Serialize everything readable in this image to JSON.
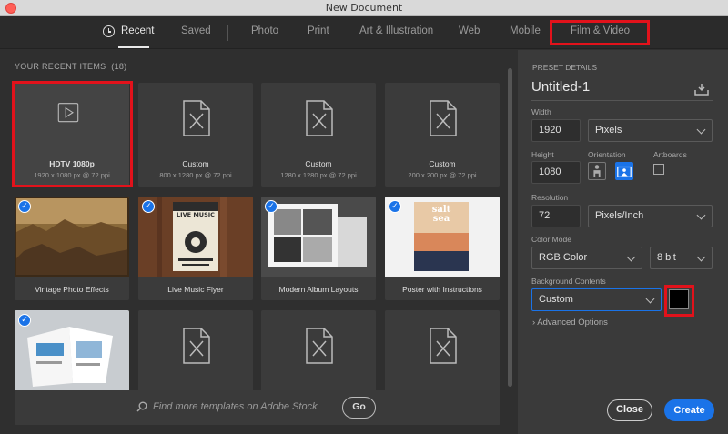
{
  "window": {
    "title": "New Document"
  },
  "tabs": [
    {
      "label": "Recent",
      "active": true
    },
    {
      "label": "Saved"
    },
    {
      "label": "Photo"
    },
    {
      "label": "Print"
    },
    {
      "label": "Art & Illustration"
    },
    {
      "label": "Web"
    },
    {
      "label": "Mobile"
    },
    {
      "label": "Film & Video"
    }
  ],
  "recent": {
    "header": "YOUR RECENT ITEMS",
    "count": "(18)",
    "items": [
      {
        "title": "HDTV 1080p",
        "sub": "1920 x 1080 px @ 72 ppi",
        "icon": "video-icon",
        "selected": true
      },
      {
        "title": "Custom",
        "sub": "800 x 1280 px @ 72 ppi",
        "icon": "document-icon"
      },
      {
        "title": "Custom",
        "sub": "1280 x 1280 px @ 72 ppi",
        "icon": "document-icon"
      },
      {
        "title": "Custom",
        "sub": "200 x 200 px @ 72 ppi",
        "icon": "document-icon"
      },
      {
        "title": "Vintage Photo Effects",
        "checked": true
      },
      {
        "title": "Live Music Flyer",
        "checked": true,
        "thumb_text": "LIVE MUSIC"
      },
      {
        "title": "Modern Album Layouts",
        "checked": true
      },
      {
        "title": "Poster with Instructions",
        "checked": true,
        "thumb_text_1": "salt",
        "thumb_text_2": "sea"
      },
      {
        "title": "",
        "checked": true
      },
      {
        "title": "",
        "icon": "document-icon"
      },
      {
        "title": "",
        "icon": "document-icon"
      },
      {
        "title": "",
        "icon": "document-icon"
      }
    ]
  },
  "stock": {
    "placeholder": "Find more templates on Adobe Stock",
    "go_label": "Go"
  },
  "preset": {
    "header": "PRESET DETAILS",
    "name": "Untitled-1",
    "width_label": "Width",
    "width_value": "1920",
    "width_unit": "Pixels",
    "height_label": "Height",
    "height_value": "1080",
    "orientation_label": "Orientation",
    "orientation": "landscape",
    "artboards_label": "Artboards",
    "artboards_checked": false,
    "resolution_label": "Resolution",
    "resolution_value": "72",
    "resolution_unit": "Pixels/Inch",
    "color_mode_label": "Color Mode",
    "color_mode": "RGB Color",
    "bit_depth": "8 bit",
    "bg_label": "Background Contents",
    "bg_value": "Custom",
    "bg_color": "#000000",
    "advanced_label": "Advanced Options",
    "close_label": "Close",
    "create_label": "Create"
  },
  "colors": {
    "accent": "#1a73e8",
    "highlight": "#e2121b"
  }
}
